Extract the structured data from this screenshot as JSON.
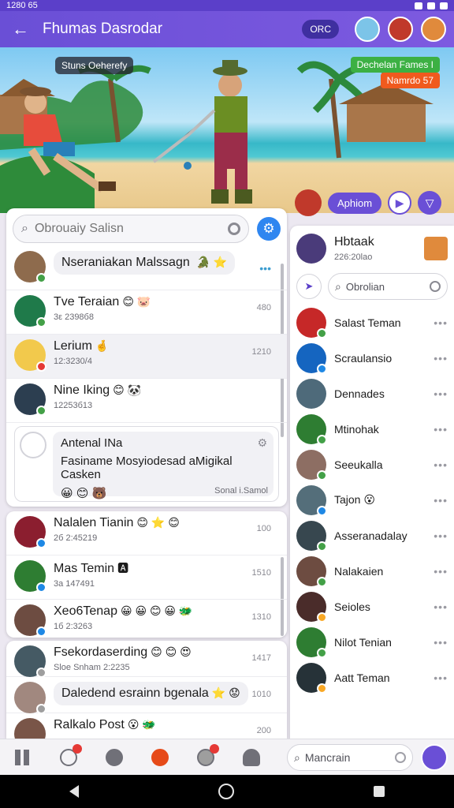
{
  "status_bar": {
    "time": "1280 65"
  },
  "app": {
    "title": "Fhumas Dasrodar",
    "pill": "ORC"
  },
  "scene": {
    "badge": "Stuns Oeherefy",
    "tag_green": "Dechelan Fames I",
    "tag_orange": "Namrdo 57",
    "pill_label": "Aphiom"
  },
  "search": {
    "placeholder": "Obrouaiy Salisn"
  },
  "chats": [
    {
      "name": "Nseraniakan Malssagn",
      "time": "",
      "sub": "",
      "emoji": "🐊 ⭐",
      "dot": "#43a047"
    },
    {
      "name": "Tve Teraian",
      "time": "480",
      "sub": "3ε 2398б8",
      "emoji": "😊 🐷",
      "dot": "#43a047"
    },
    {
      "name": "Lerium",
      "time": "1210",
      "sub": "12:3230/4",
      "emoji": "🤞",
      "dot": "#e53935"
    },
    {
      "name": "Nine Iking",
      "time": "",
      "sub": "12253б13",
      "emoji": "😊 🐼",
      "dot": "#43a047"
    }
  ],
  "card": {
    "title": "Antenal INa",
    "text": "Fasiname Mosyiodesad aMigikal Casken",
    "emojis": "😀 😊 🐻",
    "signature": "Sonal i.Samol"
  },
  "chats2": [
    {
      "name": "Nalalen Tianin",
      "time": "100",
      "sub": "2б 2:45219",
      "emoji": "😊 ⭐ 😊",
      "dot": "#1e88e5"
    },
    {
      "name": "Mas Temin",
      "time": "1510",
      "sub": "3a 147491",
      "emoji": "🅰",
      "dot": "#1e88e5"
    },
    {
      "name": "Xeo6Tenap",
      "time": "1310",
      "sub": "1б 2:3263",
      "emoji": "😀 😀 😊 😀 🐲",
      "dot": "#1e88e5"
    }
  ],
  "chats3": [
    {
      "name": "Fsekordaserding",
      "time": "1417",
      "sub": "Sloe Snham 2:2235",
      "emoji": "😊 😊 😍",
      "dot": "#9e9e9e"
    },
    {
      "name": "Daledend esrainn bgenala",
      "time": "1010",
      "sub": "",
      "emoji": "⭐ 😟",
      "dot": "#9e9e9e"
    },
    {
      "name": "Ralkalo Post",
      "time": "200",
      "sub": "",
      "emoji": "😮 🐲",
      "dot": "#9e9e9e"
    }
  ],
  "right_panel": {
    "title": "Hbtaak",
    "time": "226:20lao",
    "search_placeholder": "Obrolian",
    "contacts": [
      {
        "name": "Salast Teman",
        "dot": "#43a047"
      },
      {
        "name": "Scraulansio",
        "dot": "#1e88e5"
      },
      {
        "name": "Dennades",
        "dot": ""
      },
      {
        "name": "Mtinohak",
        "dot": "#43a047"
      },
      {
        "name": "Seeukalla",
        "dot": "#43a047"
      },
      {
        "name": "Tajon",
        "emoji": "😮",
        "dot": "#1e88e5"
      },
      {
        "name": "Asseranadalay",
        "dot": "#43a047"
      },
      {
        "name": "Nalakaien",
        "dot": "#43a047"
      },
      {
        "name": "Seioles",
        "dot": "#f9a825"
      },
      {
        "name": "Nilot Tenian",
        "dot": "#43a047"
      },
      {
        "name": "Aatt Teman",
        "dot": "#f9a825"
      }
    ]
  },
  "bottom_nav": {
    "search_placeholder": "Mancrain"
  },
  "colors": {
    "accent": "#6a4fd6",
    "bar": "#5b3fc9",
    "blue": "#2f86f0"
  }
}
